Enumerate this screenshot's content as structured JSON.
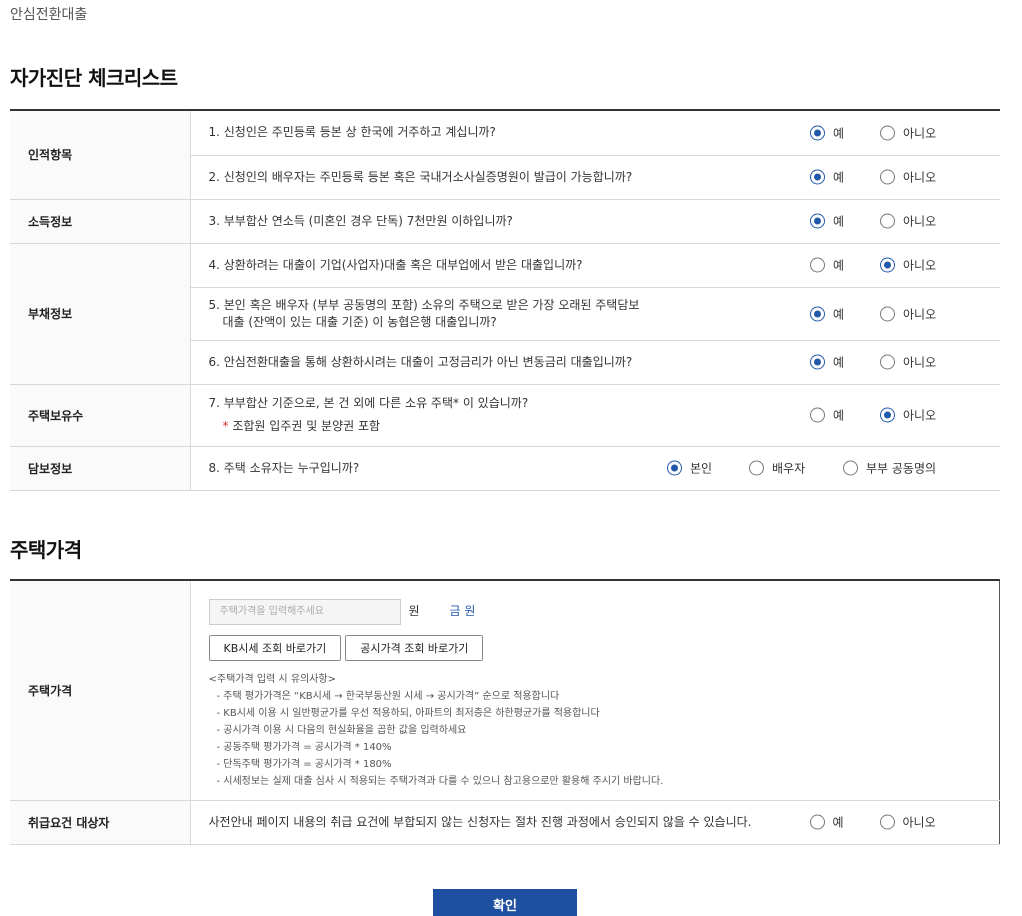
{
  "breadcrumb": "안심전환대출",
  "section1_title": "자가진단 체크리스트",
  "section2_title": "주택가격",
  "groups": {
    "identity": "인적항목",
    "income": "소득정보",
    "debt": "부채정보",
    "house": "주택보유수",
    "collateral": "담보정보"
  },
  "questions": {
    "q1": "1. 신청인은 주민등록 등본 상 한국에 거주하고 계십니까?",
    "q2": "2. 신청인의 배우자는 주민등록 등본 혹은 국내거소사실증명원이 발급이 가능합니까?",
    "q3": "3. 부부합산 연소득 (미혼인 경우 단독) 7천만원 이하입니까?",
    "q4": "4. 상환하려는 대출이 기업(사업자)대출 혹은 대부업에서 받은 대출입니까?",
    "q5_line1": "5. 본인 혹은 배우자 (부부 공동명의 포함) 소유의 주택으로 받은 가장 오래된 주택담보",
    "q5_line2": "대출 (잔액이 있는 대출 기준) 이 농협은행 대출입니까?",
    "q6": "6. 안심전환대출을 통해 상환하시려는 대출이 고정금리가 아닌 변동금리 대출입니까?",
    "q7": "7. 부부합산 기준으로, 본 건 외에 다른 소유 주택* 이 있습니까?",
    "q7_note_star": "*",
    "q7_note": "조합원 입주권 및 분양권 포함",
    "q8": "8. 주택 소유자는 누구입니까?"
  },
  "options": {
    "yes": "예",
    "no": "아니오",
    "self": "본인",
    "spouse": "배우자",
    "joint": "부부 공동명의"
  },
  "answers": {
    "q1": "yes",
    "q2": "yes",
    "q3": "yes",
    "q4": "no",
    "q5": "yes",
    "q6": "yes",
    "q7": "no",
    "q8": "self",
    "eligibility": "none"
  },
  "price": {
    "label": "주택가격",
    "placeholder": "주택가격을 입력해주세요",
    "unit": "원",
    "amount_text": "금 원",
    "kb_button": "KB시세 조회 바로가기",
    "public_button": "공시가격 조회 바로가기",
    "notes_title": "<주택가격 입력 시 유의사항>",
    "notes": [
      "- 주택 평가가격은 “KB시세 → 한국부동산원 시세 → 공시가격” 순으로 적용합니다",
      "- KB시세 이용 시 일반평균가를 우선 적용하되, 아파트의 최저층은 하한평균가를 적용합니다",
      "- 공시가격 이용 시 다음의 현실화율을 곱한 값을 입력하세요",
      "- 공동주택 평가가격 = 공시가격 * 140%",
      "- 단독주택 평가가격 = 공시가격 * 180%",
      "- 시세정보는 실제 대출 심사 시 적용되는 주택가격과 다를 수 있으니 참고용으로만 활용해 주시기 바랍니다."
    ]
  },
  "eligibility": {
    "label": "취급요건 대상자",
    "text": "사전안내 페이지 내용의 취급 요건에 부합되지 않는 신청자는 절차 진행 과정에서 승인되지 않을 수 있습니다."
  },
  "confirm_label": "확인",
  "colors": {
    "accent": "#1f4fa0",
    "radio_on": "#2258a8",
    "note_star": "#d62a2a"
  }
}
